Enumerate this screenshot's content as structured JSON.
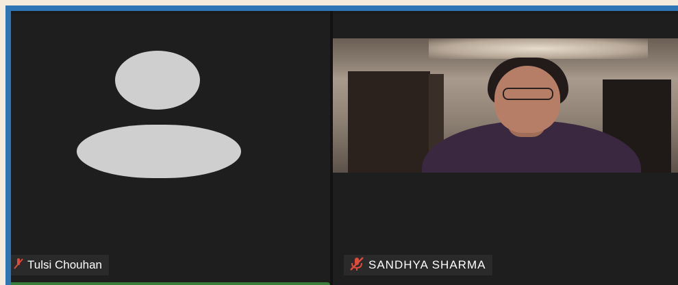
{
  "participants": [
    {
      "name": "Tulsi Chouhan",
      "muted": true,
      "video_on": false,
      "avatar_icon": "person-silhouette-icon"
    },
    {
      "name": "SANDHYA SHARMA",
      "muted": true,
      "video_on": true,
      "mute_icon_color": "#e04a3a"
    }
  ],
  "colors": {
    "frame_border": "#2e75b6",
    "page_background": "#f4ebdc",
    "tile_background": "#1e1e1e",
    "name_tag_background": "#2a2a2a",
    "mute_icon": "#e04a3a",
    "active_indicator": "#3b7d3b"
  }
}
